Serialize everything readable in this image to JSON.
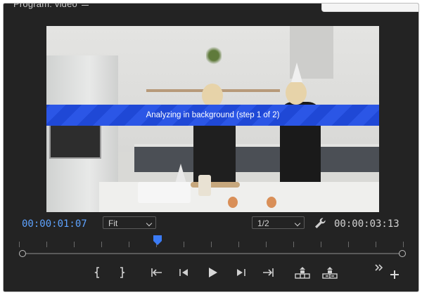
{
  "panel": {
    "title": "Program: video",
    "menu_icon": "hamburger-menu-icon"
  },
  "viewer": {
    "status_message": "Analyzing in background (step 1 of 2)",
    "banner_color": "#1f48d6"
  },
  "controls": {
    "current_timecode": "00:00:01:07",
    "duration_timecode": "00:00:03:13",
    "zoom_select": {
      "value": "Fit"
    },
    "resolution_select": {
      "value": "1/2"
    },
    "settings_icon": "wrench-icon"
  },
  "colors": {
    "accent": "#5ea3ff",
    "panel_bg": "#232323",
    "text": "#d2d2d2",
    "playhead": "#3b7bf5"
  },
  "transport": {
    "buttons": [
      {
        "name": "mark-in-button",
        "icon": "mark-in-icon"
      },
      {
        "name": "mark-out-button",
        "icon": "mark-out-icon"
      },
      {
        "name": "go-to-in-button",
        "icon": "go-to-in-icon"
      },
      {
        "name": "step-back-button",
        "icon": "step-back-icon"
      },
      {
        "name": "play-button",
        "icon": "play-icon"
      },
      {
        "name": "step-forward-button",
        "icon": "step-forward-icon"
      },
      {
        "name": "go-to-out-button",
        "icon": "go-to-out-icon"
      },
      {
        "name": "lift-button",
        "icon": "lift-icon"
      },
      {
        "name": "extract-button",
        "icon": "extract-icon"
      },
      {
        "name": "more-controls-button",
        "icon": "double-chevron-right-icon"
      },
      {
        "name": "button-editor",
        "icon": "plus-icon"
      }
    ]
  }
}
